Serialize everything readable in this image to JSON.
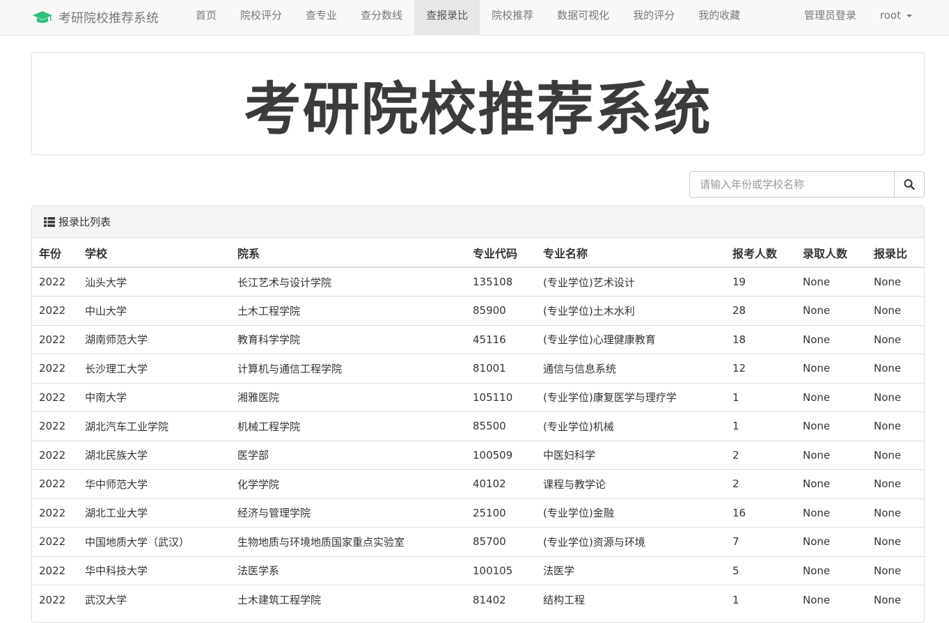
{
  "navbar": {
    "brand": "考研院校推荐系统",
    "links": [
      "首页",
      "院校评分",
      "查专业",
      "查分数线",
      "查报录比",
      "院校推荐",
      "数据可视化",
      "我的评分",
      "我的收藏"
    ],
    "active_link": "查报录比",
    "admin_login": "管理员登录",
    "user": "root"
  },
  "jumbotron": {
    "title": "考研院校推荐系统"
  },
  "search": {
    "placeholder": "请输入年份或学校名称"
  },
  "panel": {
    "heading": "报录比列表",
    "columns": [
      "年份",
      "学校",
      "院系",
      "专业代码",
      "专业名称",
      "报考人数",
      "录取人数",
      "报录比"
    ],
    "rows": [
      [
        "2022",
        "汕头大学",
        "长江艺术与设计学院",
        "135108",
        "(专业学位)艺术设计",
        "19",
        "None",
        "None"
      ],
      [
        "2022",
        "中山大学",
        "土木工程学院",
        "85900",
        "(专业学位)土木水利",
        "28",
        "None",
        "None"
      ],
      [
        "2022",
        "湖南师范大学",
        "教育科学学院",
        "45116",
        "(专业学位)心理健康教育",
        "18",
        "None",
        "None"
      ],
      [
        "2022",
        "长沙理工大学",
        "计算机与通信工程学院",
        "81001",
        "通信与信息系统",
        "12",
        "None",
        "None"
      ],
      [
        "2022",
        "中南大学",
        "湘雅医院",
        "105110",
        "(专业学位)康复医学与理疗学",
        "1",
        "None",
        "None"
      ],
      [
        "2022",
        "湖北汽车工业学院",
        "机械工程学院",
        "85500",
        "(专业学位)机械",
        "1",
        "None",
        "None"
      ],
      [
        "2022",
        "湖北民族大学",
        "医学部",
        "100509",
        "中医妇科学",
        "2",
        "None",
        "None"
      ],
      [
        "2022",
        "华中师范大学",
        "化学学院",
        "40102",
        "课程与教学论",
        "2",
        "None",
        "None"
      ],
      [
        "2022",
        "湖北工业大学",
        "经济与管理学院",
        "25100",
        "(专业学位)金融",
        "16",
        "None",
        "None"
      ],
      [
        "2022",
        "中国地质大学（武汉）",
        "生物地质与环境地质国家重点实验室",
        "85700",
        "(专业学位)资源与环境",
        "7",
        "None",
        "None"
      ],
      [
        "2022",
        "华中科技大学",
        "法医学系",
        "100105",
        "法医学",
        "5",
        "None",
        "None"
      ],
      [
        "2022",
        "武汉大学",
        "土木建筑工程学院",
        "81402",
        "结构工程",
        "1",
        "None",
        "None"
      ]
    ]
  }
}
